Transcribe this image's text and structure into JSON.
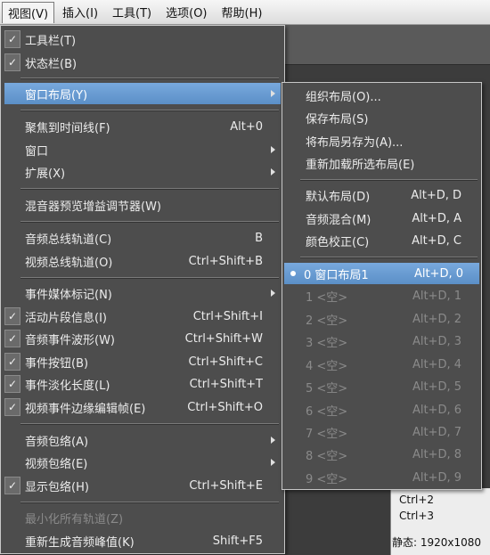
{
  "menubar": {
    "items": [
      "视图(V)",
      "插入(I)",
      "工具(T)",
      "选项(O)",
      "帮助(H)"
    ]
  },
  "main_menu": {
    "items": [
      {
        "label": "工具栏(T)",
        "checked": true
      },
      {
        "label": "状态栏(B)",
        "checked": true
      },
      {
        "label": "窗口布局(Y)",
        "submenu": true,
        "highlight": true
      },
      {
        "label": "聚焦到时间线(F)",
        "shortcut": "Alt+0"
      },
      {
        "label": "窗口",
        "submenu": true
      },
      {
        "label": "扩展(X)",
        "submenu": true
      },
      {
        "label": "混音器预览增益调节器(W)"
      },
      {
        "label": "音频总线轨道(C)",
        "shortcut": "B"
      },
      {
        "label": "视频总线轨道(O)",
        "shortcut": "Ctrl+Shift+B"
      },
      {
        "label": "事件媒体标记(N)",
        "submenu": true
      },
      {
        "label": "活动片段信息(I)",
        "checked": true,
        "shortcut": "Ctrl+Shift+I"
      },
      {
        "label": "音频事件波形(W)",
        "checked": true,
        "shortcut": "Ctrl+Shift+W"
      },
      {
        "label": "事件按钮(B)",
        "checked": true,
        "shortcut": "Ctrl+Shift+C"
      },
      {
        "label": "事件淡化长度(L)",
        "checked": true,
        "shortcut": "Ctrl+Shift+T"
      },
      {
        "label": "视频事件边缘编辑帧(E)",
        "checked": true,
        "shortcut": "Ctrl+Shift+O"
      },
      {
        "label": "音频包络(A)",
        "submenu": true
      },
      {
        "label": "视频包络(E)",
        "submenu": true
      },
      {
        "label": "显示包络(H)",
        "checked": true,
        "shortcut": "Ctrl+Shift+E"
      },
      {
        "label": "最小化所有轨道(Z)",
        "disabled": true
      },
      {
        "label": "重新生成音频峰值(K)",
        "shortcut": "Shift+F5"
      }
    ]
  },
  "sub_menu": {
    "items": [
      {
        "label": "组织布局(O)..."
      },
      {
        "label": "保存布局(S)"
      },
      {
        "label": "将布局另存为(A)..."
      },
      {
        "label": "重新加载所选布局(E)"
      },
      {
        "label": "默认布局(D)",
        "shortcut": "Alt+D, D"
      },
      {
        "label": "音频混合(M)",
        "shortcut": "Alt+D, A"
      },
      {
        "label": "颜色校正(C)",
        "shortcut": "Alt+D, C"
      },
      {
        "label": "0 窗口布局1",
        "shortcut": "Alt+D, 0",
        "highlight": true,
        "selected": true
      },
      {
        "label": "1 <空>",
        "shortcut": "Alt+D, 1",
        "disabled": true
      },
      {
        "label": "2 <空>",
        "shortcut": "Alt+D, 2",
        "disabled": true
      },
      {
        "label": "3 <空>",
        "shortcut": "Alt+D, 3",
        "disabled": true
      },
      {
        "label": "4 <空>",
        "shortcut": "Alt+D, 4",
        "disabled": true
      },
      {
        "label": "5 <空>",
        "shortcut": "Alt+D, 5",
        "disabled": true
      },
      {
        "label": "6 <空>",
        "shortcut": "Alt+D, 6",
        "disabled": true
      },
      {
        "label": "7 <空>",
        "shortcut": "Alt+D, 7",
        "disabled": true
      },
      {
        "label": "8 <空>",
        "shortcut": "Alt+D, 8",
        "disabled": true
      },
      {
        "label": "9 <空>",
        "shortcut": "Alt+D, 9",
        "disabled": true
      }
    ]
  },
  "background_panel": {
    "shortcuts": [
      "Ctrl+2",
      "Ctrl+3"
    ],
    "status": "静态: 1920x1080"
  },
  "colors": {
    "menu_bg": "#4d4d4d",
    "highlight": "#6a9ed6",
    "disabled": "#8a8a8a"
  }
}
